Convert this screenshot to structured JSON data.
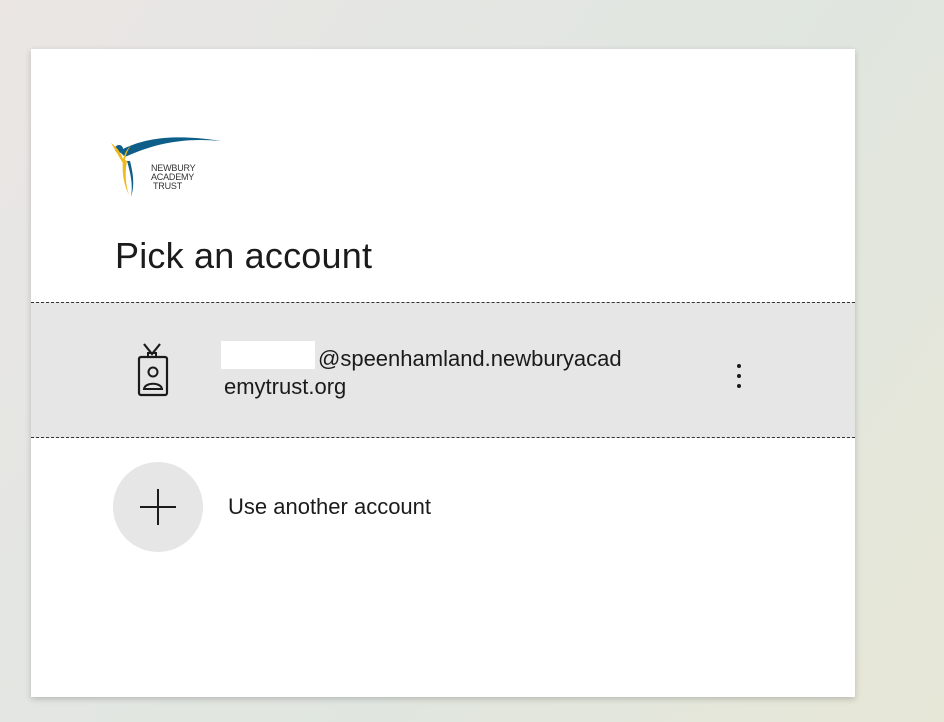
{
  "org": {
    "logo_lines": [
      "NEWBURY",
      "ACADEMY",
      "TRUST"
    ]
  },
  "page": {
    "title": "Pick an account"
  },
  "account": {
    "email_line1": "@speenhamland.newburyacad",
    "email_line2": "emytrust.org",
    "icon": "id-badge-icon",
    "more_icon": "more-options-icon"
  },
  "another": {
    "label": "Use another account",
    "icon": "plus-icon"
  },
  "colors": {
    "logo_blue": "#0d5f8a",
    "logo_yellow": "#f2b71b",
    "row_hover": "#e6e6e6",
    "text": "#1b1b1b"
  }
}
